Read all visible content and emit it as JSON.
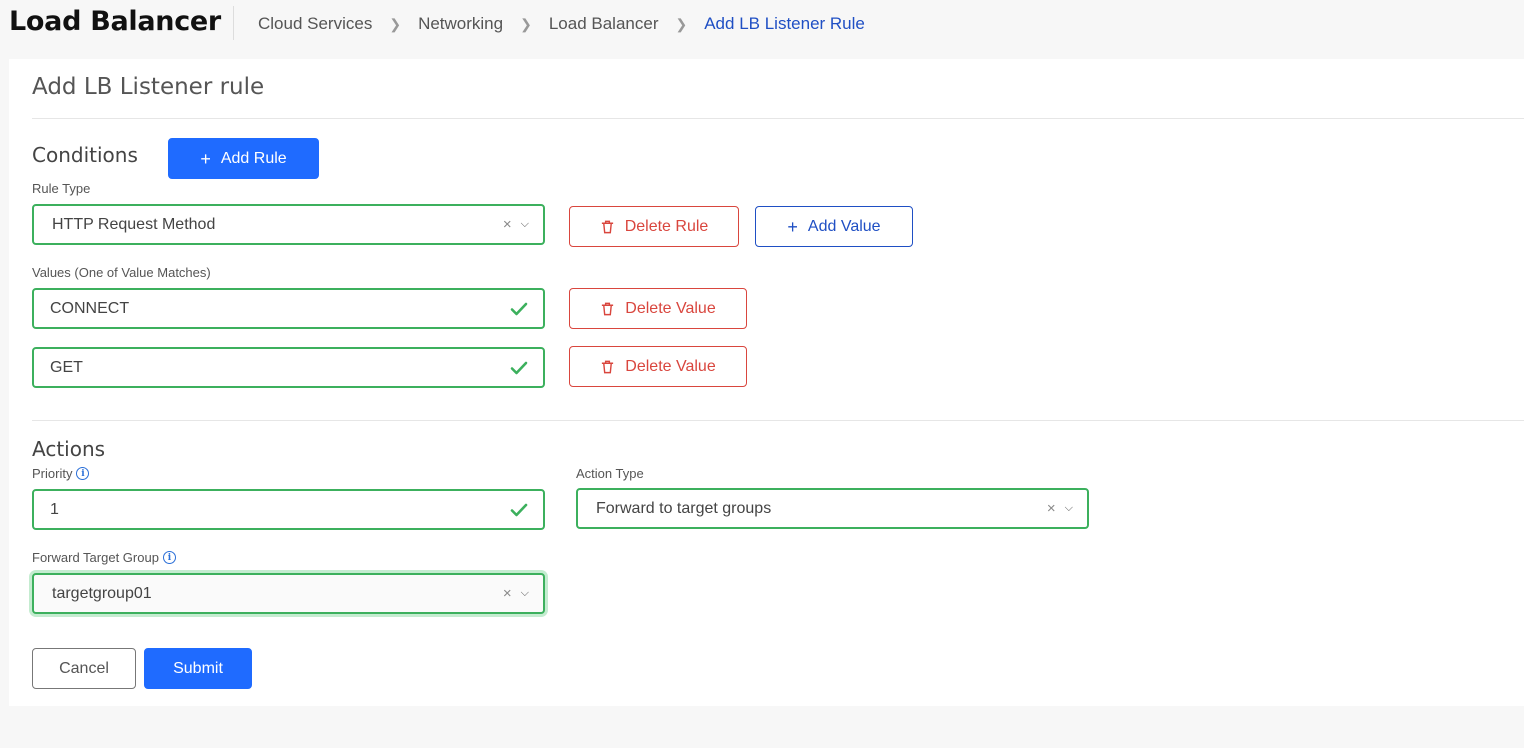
{
  "header": {
    "app_title": "Load Balancer",
    "breadcrumbs": [
      "Cloud Services",
      "Networking",
      "Load Balancer",
      "Add LB Listener Rule"
    ]
  },
  "page": {
    "title": "Add LB Listener rule"
  },
  "conditions": {
    "title": "Conditions",
    "add_rule_label": "Add Rule",
    "rule_type_label": "Rule Type",
    "rule_type_value": "HTTP Request Method",
    "delete_rule_label": "Delete Rule",
    "add_value_label": "Add Value",
    "values_label": "Values (One of Value Matches)",
    "values": [
      "CONNECT",
      "GET"
    ],
    "delete_value_label": "Delete Value"
  },
  "actions": {
    "title": "Actions",
    "priority_label": "Priority",
    "priority_value": "1",
    "action_type_label": "Action Type",
    "action_type_value": "Forward to target groups",
    "target_group_label": "Forward Target Group",
    "target_group_value": "targetgroup01"
  },
  "footer": {
    "cancel_label": "Cancel",
    "submit_label": "Submit"
  },
  "icons": {
    "clear": "clear-icon",
    "chevron": "chevron-down-icon",
    "check": "check-icon",
    "trash": "trash-icon",
    "plus": "plus-icon",
    "info": "info-icon"
  },
  "colors": {
    "primary": "#1f6bff",
    "danger": "#d9463e",
    "success": "#3cb05d",
    "link": "#1f4fc4"
  }
}
